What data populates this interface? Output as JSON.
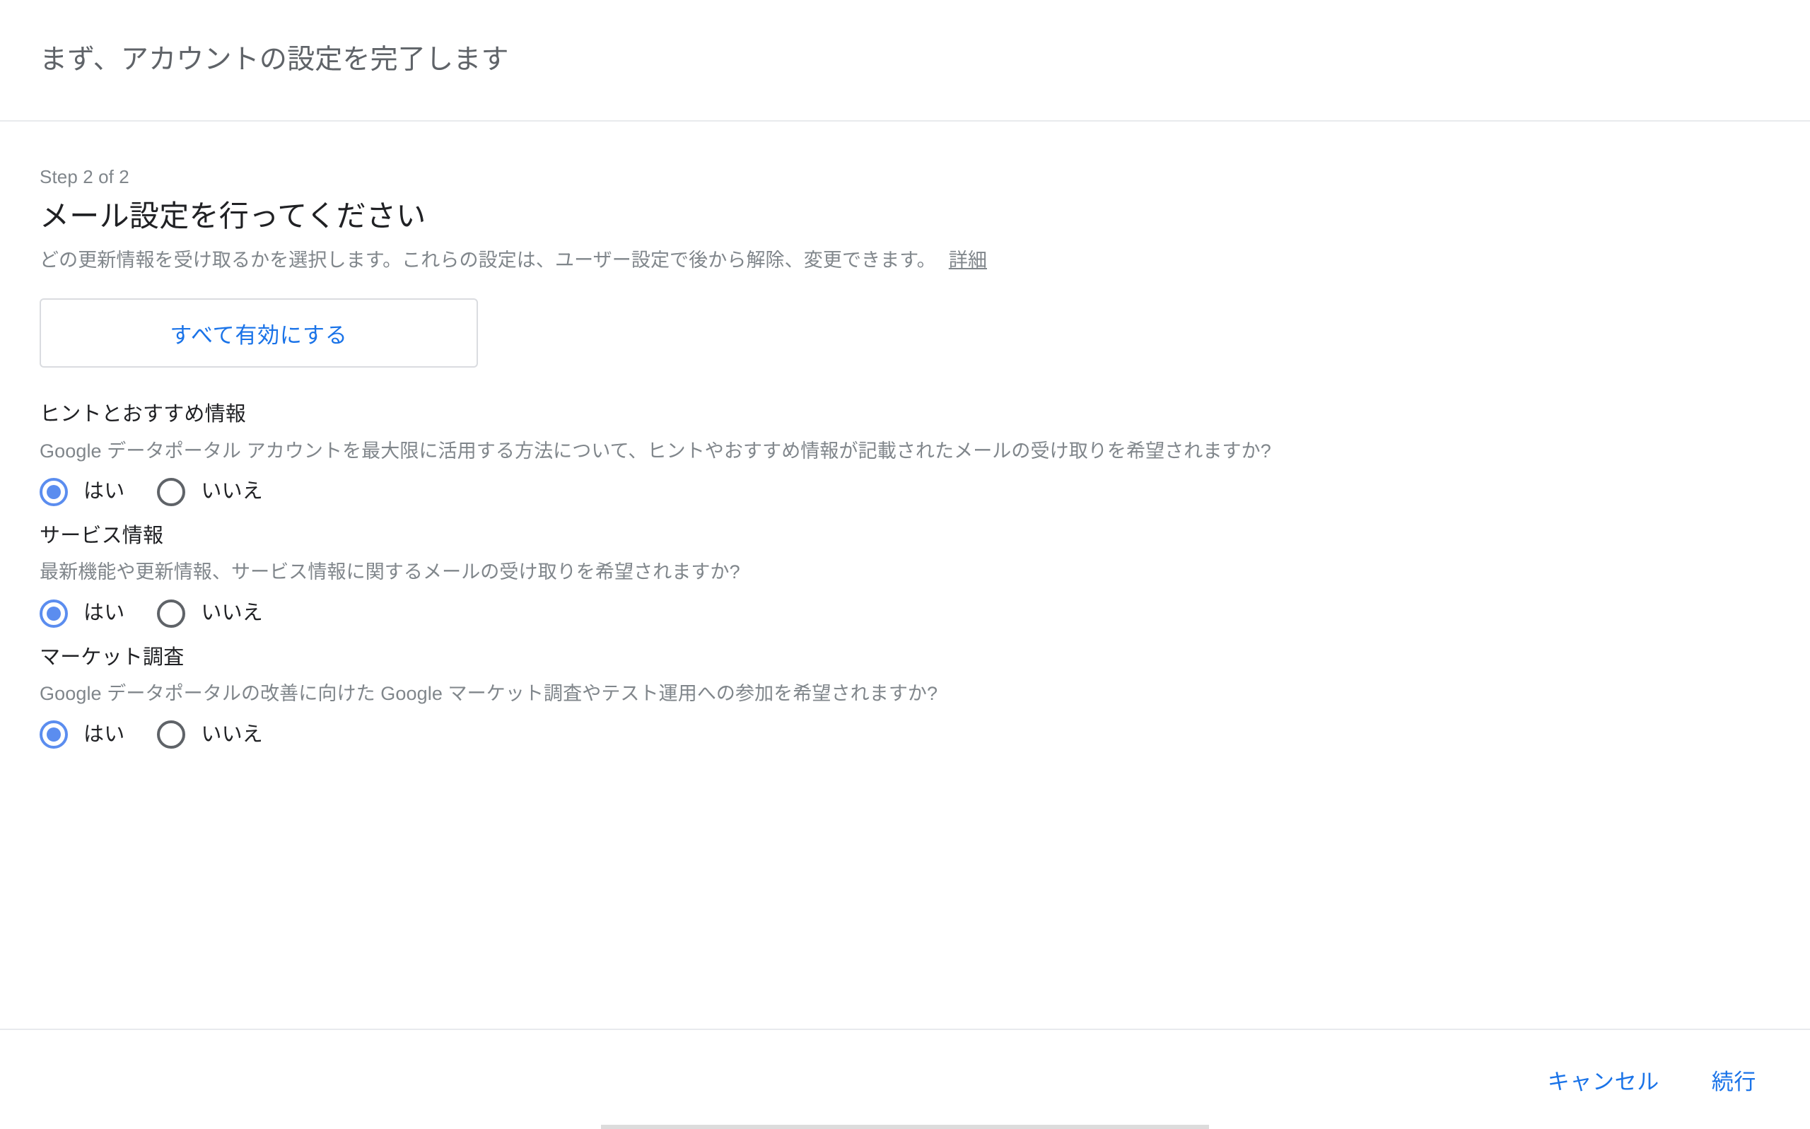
{
  "header": {
    "title": "まず、アカウントの設定を完了します"
  },
  "step": {
    "label": "Step 2 of 2",
    "heading": "メール設定を行ってください",
    "description": "どの更新情報を受け取るかを選択します。これらの設定は、ユーザー設定で後から解除、変更できます。",
    "more_link": "詳細"
  },
  "enable_all_button": {
    "label": "すべて有効にする"
  },
  "preferences": [
    {
      "title": "ヒントとおすすめ情報",
      "question": "Google データポータル アカウントを最大限に活用する方法について、ヒントやおすすめ情報が記載されたメールの受け取りを希望されますか?",
      "options": [
        {
          "label": "はい",
          "selected": true
        },
        {
          "label": "いいえ",
          "selected": false
        }
      ]
    },
    {
      "title": "サービス情報",
      "question": "最新機能や更新情報、サービス情報に関するメールの受け取りを希望されますか?",
      "options": [
        {
          "label": "はい",
          "selected": true
        },
        {
          "label": "いいえ",
          "selected": false
        }
      ]
    },
    {
      "title": "マーケット調査",
      "question": "Google データポータルの改善に向けた Google マーケット調査やテスト運用への参加を希望されますか?",
      "options": [
        {
          "label": "はい",
          "selected": true
        },
        {
          "label": "いいえ",
          "selected": false
        }
      ]
    }
  ],
  "footer": {
    "cancel_label": "キャンセル",
    "continue_label": "続行"
  },
  "colors": {
    "accent_blue": "#1a73e8",
    "radio_blue": "#5b8def",
    "text_primary": "#202124",
    "text_secondary": "#80868b",
    "divider": "#e8eaed",
    "border": "#dadce0"
  }
}
